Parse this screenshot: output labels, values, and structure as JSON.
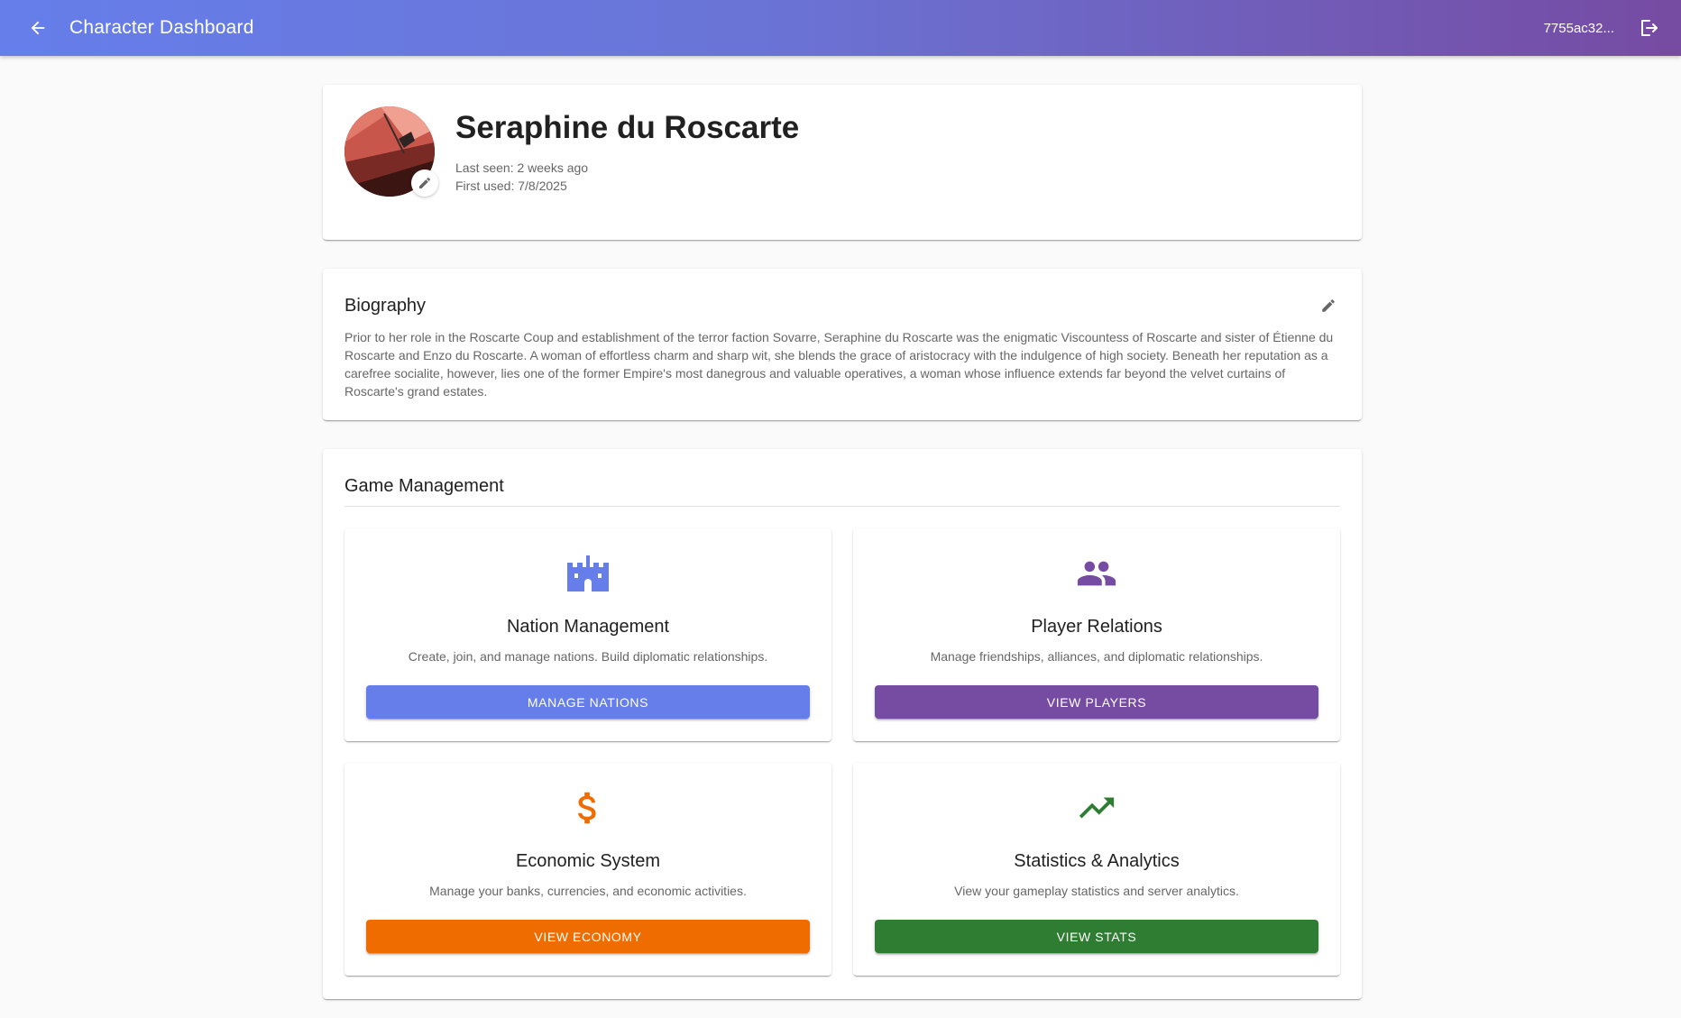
{
  "appbar": {
    "title": "Character Dashboard",
    "user_id": "7755ac32...",
    "back_icon": "arrow-back-icon",
    "logout_icon": "logout-icon"
  },
  "profile": {
    "name": "Seraphine du Roscarte",
    "last_seen": "Last seen: 2 weeks ago",
    "first_used": "First used: 7/8/2025"
  },
  "biography": {
    "title": "Biography",
    "text": "Prior to her role in the Roscarte Coup and establishment of the terror faction Sovarre, Seraphine du Roscarte was the enigmatic Viscountess of Roscarte and sister of Étienne du Roscarte and Enzo du Roscarte. A woman of effortless charm and sharp wit, she blends the grace of aristocracy with the indulgence of high society. Beneath her reputation as a carefree socialite, however, lies one of the former Empire's most danegrous and valuable operatives, a woman whose influence extends far beyond the velvet curtains of Roscarte's grand estates."
  },
  "game_management": {
    "title": "Game Management",
    "tiles": [
      {
        "title": "Nation Management",
        "description": "Create, join, and manage nations. Build diplomatic relationships.",
        "button": "MANAGE NATIONS",
        "icon": "castle-icon",
        "color": "#667eea"
      },
      {
        "title": "Player Relations",
        "description": "Manage friendships, alliances, and diplomatic relationships.",
        "button": "VIEW PLAYERS",
        "icon": "people-icon",
        "color": "#764ba2"
      },
      {
        "title": "Economic System",
        "description": "Manage your banks, currencies, and economic activities.",
        "button": "VIEW ECONOMY",
        "icon": "dollar-icon",
        "color": "#ef6c00"
      },
      {
        "title": "Statistics & Analytics",
        "description": "View your gameplay statistics and server analytics.",
        "button": "VIEW STATS",
        "icon": "trending-up-icon",
        "color": "#2e7d32"
      }
    ]
  }
}
